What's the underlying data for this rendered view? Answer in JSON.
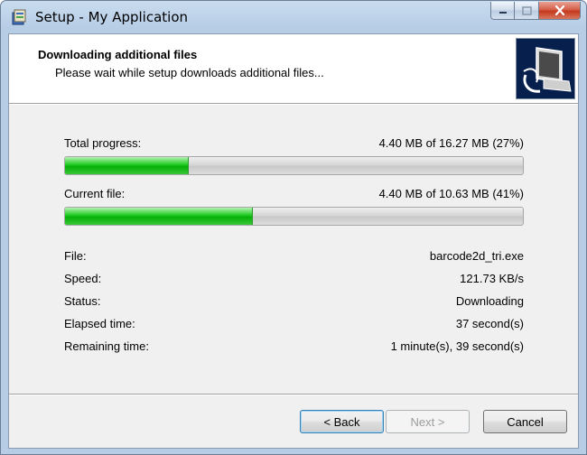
{
  "window": {
    "title": "Setup - My Application",
    "icons": {
      "app": "setup-app-icon",
      "minimize": "minimize-icon",
      "maximize": "maximize-icon",
      "close": "close-icon"
    }
  },
  "header": {
    "title": "Downloading additional files",
    "subtitle": "Please wait while setup downloads additional files...",
    "image": "computer-setup-icon"
  },
  "progress": {
    "total": {
      "label": "Total progress:",
      "value": "4.40 MB of 16.27 MB (27%)",
      "fraction": 0.27
    },
    "current": {
      "label": "Current file:",
      "value": "4.40 MB of 10.63 MB (41%)",
      "fraction": 0.41
    }
  },
  "details": [
    {
      "label": "File:",
      "value": "barcode2d_tri.exe"
    },
    {
      "label": "Speed:",
      "value": "121.73 KB/s"
    },
    {
      "label": "Status:",
      "value": "Downloading"
    },
    {
      "label": "Elapsed time:",
      "value": "37 second(s)"
    },
    {
      "label": "Remaining time:",
      "value": "1 minute(s), 39 second(s)"
    }
  ],
  "buttons": {
    "back": "< Back",
    "next": "Next >",
    "cancel": "Cancel"
  },
  "colors": {
    "progress_fill": "#06b006",
    "header_image_bg": "#061f4d",
    "close_button": "#c4391e"
  }
}
